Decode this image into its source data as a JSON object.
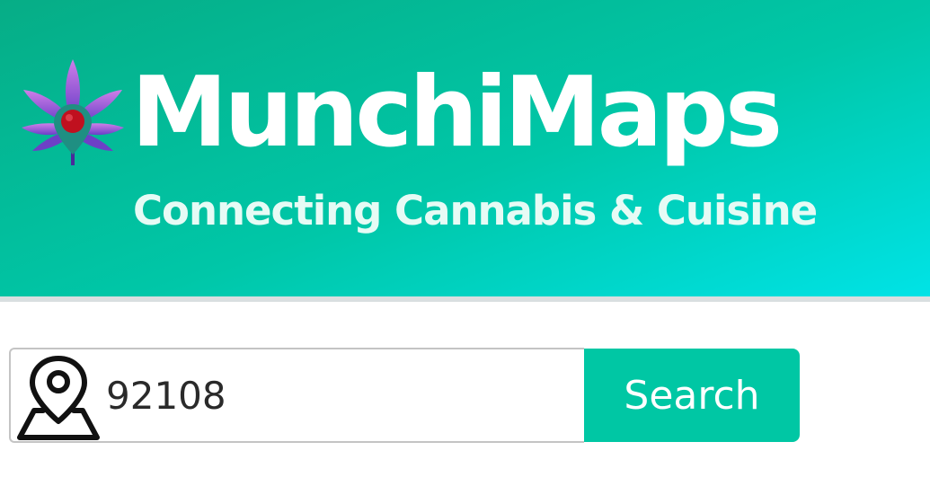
{
  "brand": {
    "title": "MunchiMaps",
    "tagline": "Connecting Cannabis & Cuisine",
    "logo_icon": "cannabis-leaf-map-pin-icon"
  },
  "search": {
    "value": "92108",
    "placeholder": "",
    "button_label": "Search",
    "location_icon": "map-pin-icon"
  },
  "colors": {
    "hero_start": "#06ad86",
    "hero_end": "#00e3e6",
    "button": "#00c7a4",
    "leaf": "#c36be0",
    "pin_dot": "#c0101f"
  }
}
